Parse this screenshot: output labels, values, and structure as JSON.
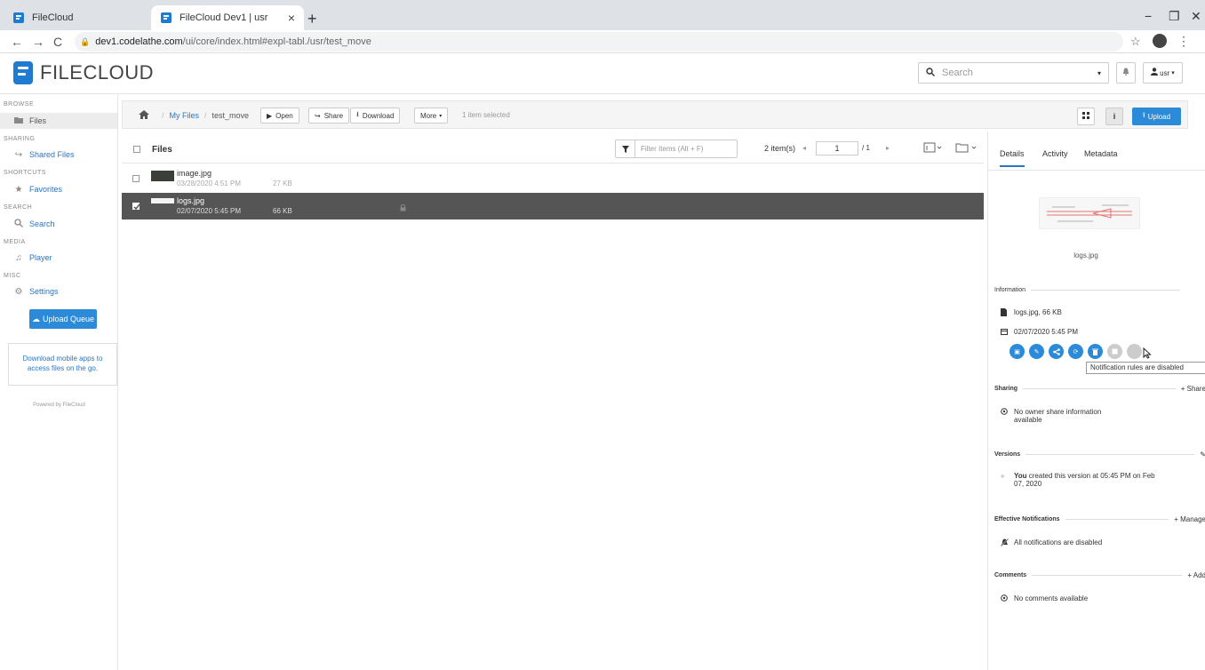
{
  "browser": {
    "tabs": [
      {
        "title": "FileCloud",
        "close": "×"
      },
      {
        "title": "FileCloud Dev1 | usr",
        "close": "×"
      }
    ],
    "new_tab": "+",
    "url_host": "dev1.codelathe.com",
    "url_path": "/ui/core/index.html#expl-tabl./usr/test_move",
    "back": "←",
    "forward": "→",
    "reload": "C",
    "star": "☆",
    "menu": "⋮",
    "minimize": "−",
    "restore": "❐",
    "close": "✕"
  },
  "header": {
    "logo_text": "FILECLOUD",
    "search_placeholder": "Search",
    "search_caret": "▾",
    "bell": "🔔",
    "user": "usr",
    "user_caret": "▾"
  },
  "sidebar": {
    "sections": {
      "browse": "BROWSE",
      "sharing": "SHARING",
      "shortcuts": "SHORTCUTS",
      "search": "SEARCH",
      "media": "MEDIA",
      "misc": "MISC"
    },
    "items": {
      "files": "Files",
      "shared_files": "Shared Files",
      "favorites": "Favorites",
      "search": "Search",
      "player": "Player",
      "settings": "Settings"
    },
    "upload_queue": "Upload Queue",
    "mobile_line1": "Download mobile apps to",
    "mobile_line2": "access files on the go.",
    "powered_by": "Powered by FileCloud"
  },
  "toolbar": {
    "breadcrumb": {
      "root": "My Files",
      "separator": "/",
      "current": "test_move"
    },
    "open": "Open",
    "share": "Share",
    "download": "Download",
    "more": "More",
    "selected_info": "1 item selected",
    "info": "i",
    "upload": "Upload"
  },
  "files_header": {
    "title": "Files",
    "filter_placeholder": "Filter Items (Alt + F)",
    "items_count": "2 item(s)",
    "page_current": "1",
    "page_total": "/ 1",
    "prev": "◂",
    "next": "▸"
  },
  "files": [
    {
      "name": "image.jpg",
      "date": "03/28/2020 4:51 PM",
      "size": "27 KB",
      "selected": false
    },
    {
      "name": "logs.jpg",
      "date": "02/07/2020 5:45 PM",
      "size": "66 KB",
      "selected": true
    }
  ],
  "details": {
    "tabs": {
      "details": "Details",
      "activity": "Activity",
      "metadata": "Metadata"
    },
    "preview_name": "logs.jpg",
    "information_label": "Information",
    "file_summary": "logs.jpg, 66 KB",
    "file_date": "02/07/2020 5:45 PM",
    "tooltip": "Notification rules are disabled",
    "sharing_label": "Sharing",
    "share_action": "+ Share",
    "sharing_text_1": "No owner share information",
    "sharing_text_2": "available",
    "versions_label": "Versions",
    "version_you": "You",
    "version_text_1": "created this version at 05:45 PM on Feb",
    "version_text_2": "07, 2020",
    "notifications_label": "Effective Notifications",
    "manage_action": "+ Manage",
    "notifications_text": "All notifications are disabled",
    "comments_label": "Comments",
    "add_action": "+ Add",
    "comments_text": "No comments available"
  },
  "colors": {
    "accent": "#2b8bd8",
    "selected_row": "#555555",
    "link": "#2b76c3"
  }
}
